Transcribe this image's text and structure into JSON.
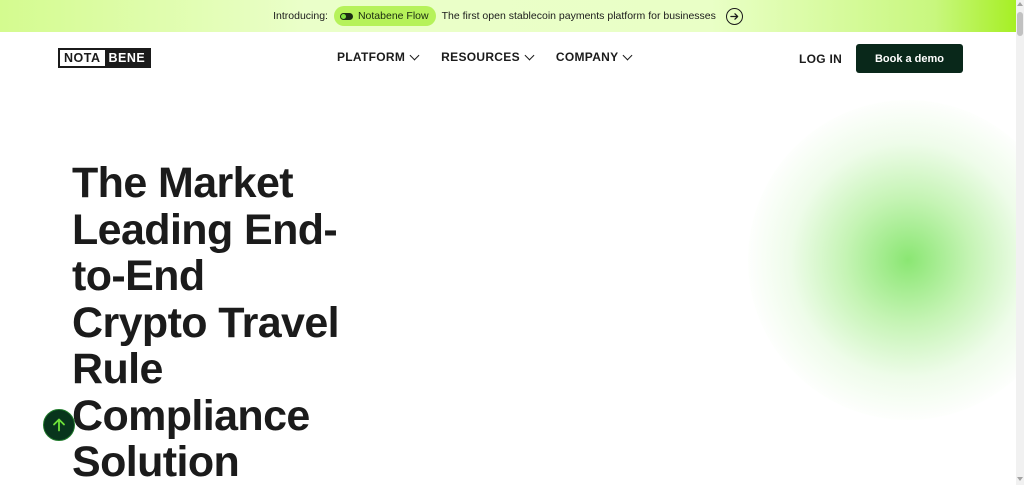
{
  "announcement": {
    "intro": "Introducing:",
    "product": "Notabene Flow",
    "tagline": "The first open stablecoin payments platform for businesses",
    "arrow_icon": "arrow-right-circle-icon"
  },
  "header": {
    "logo": {
      "left": "NOTA",
      "right": "BENE"
    },
    "nav": [
      {
        "label": "PLATFORM"
      },
      {
        "label": "RESOURCES"
      },
      {
        "label": "COMPANY"
      }
    ],
    "login": "LOG IN",
    "cta": "Book a demo"
  },
  "hero": {
    "title_lines": [
      "The Market",
      "Leading End-",
      "to-End",
      "Crypto Travel",
      "Rule",
      "Compliance",
      "Solution"
    ]
  },
  "colors": {
    "accent_green": "#a6ef24",
    "dark_green": "#09281a",
    "text": "#1b1b1b"
  },
  "icons": {
    "back_to_top": "arrow-up-icon",
    "nav_dropdown": "chevron-down-icon"
  }
}
